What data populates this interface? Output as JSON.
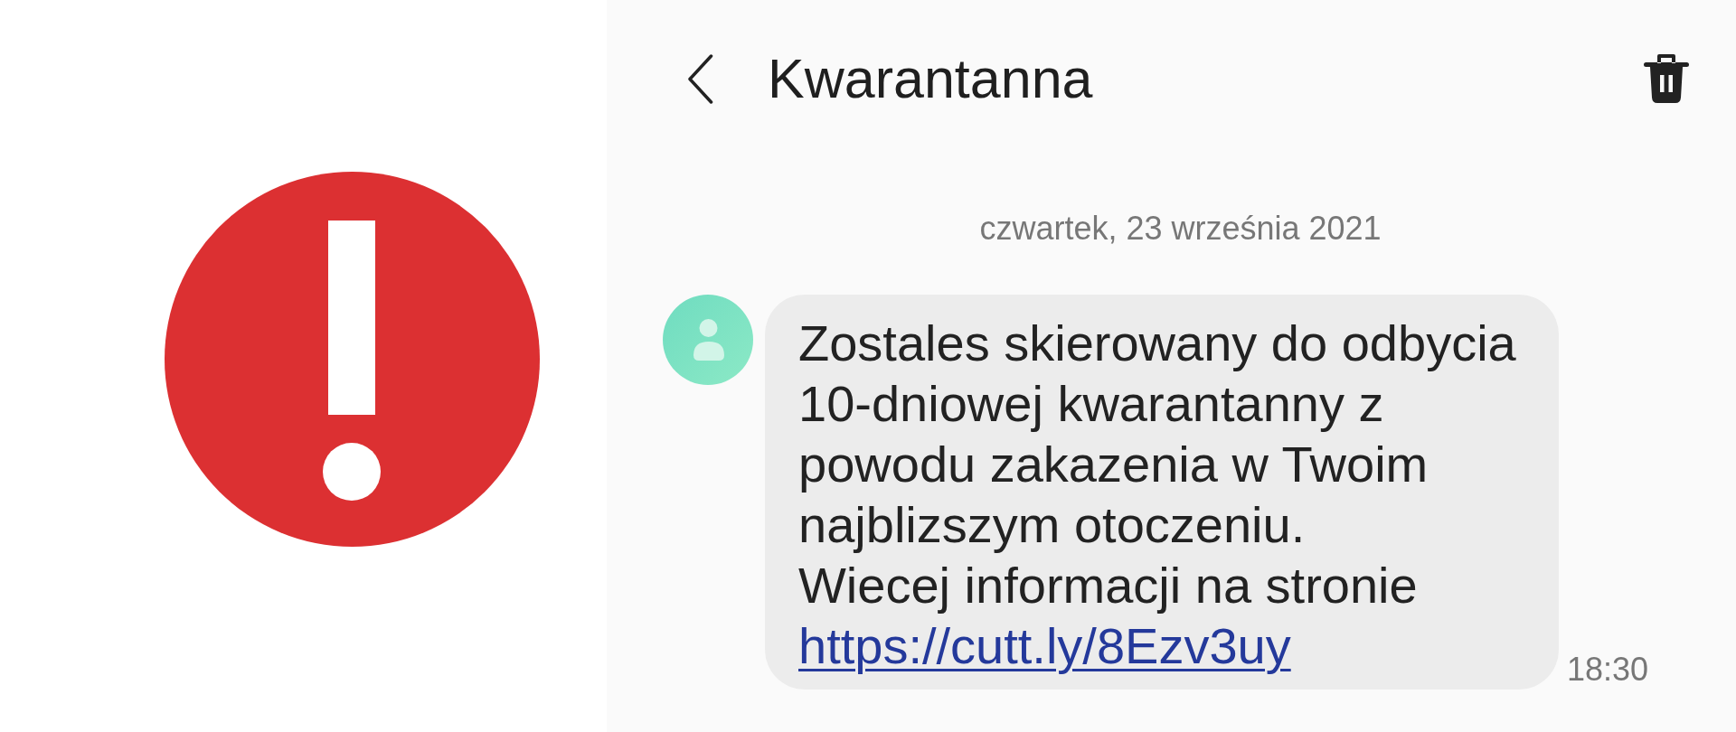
{
  "header": {
    "title": "Kwarantanna"
  },
  "conversation": {
    "date": "czwartek, 23 września 2021",
    "messages": [
      {
        "text": "Zostales skierowany do odbycia 10-dniowej kwarantanny z powodu zakazenia w Twoim najblizszym otoczeniu.\nWiecej informacji na stronie",
        "link": "https://cutt.ly/8Ezv3uy",
        "time": "18:30"
      }
    ]
  }
}
